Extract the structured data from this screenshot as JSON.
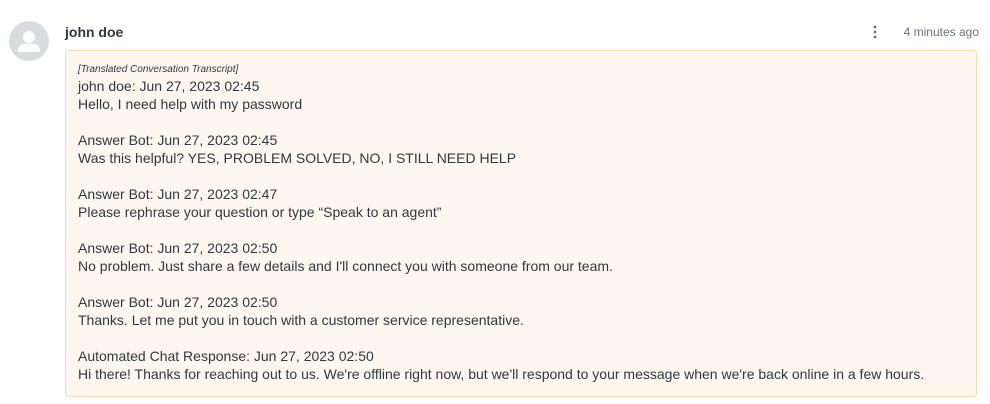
{
  "comment": {
    "author": "john doe",
    "timestamp": "4 minutes ago",
    "avatar_icon": "user-icon",
    "menu_icon": "more-vertical-icon",
    "accent_background": "#fef7ef",
    "accent_border": "#f8d9b3",
    "transcript_header": "[Translated Conversation Transcript]",
    "entries": [
      {
        "header": "john doe: Jun 27, 2023 02:45",
        "text": "Hello, I need help with my password"
      },
      {
        "header": "Answer Bot: Jun 27, 2023 02:45",
        "text": "Was this helpful? YES, PROBLEM SOLVED, NO, I STILL NEED HELP"
      },
      {
        "header": "Answer Bot: Jun 27, 2023 02:47",
        "text": "Please rephrase your question or type “Speak to an agent”"
      },
      {
        "header": "Answer Bot: Jun 27, 2023 02:50",
        "text": "No problem. Just share a few details and I'll connect you with someone from our team."
      },
      {
        "header": "Answer Bot: Jun 27, 2023 02:50",
        "text": "Thanks. Let me put you in touch with a customer service representative."
      },
      {
        "header": "Automated Chat Response: Jun 27, 2023 02:50",
        "text": "Hi there! Thanks for reaching out to us. We're offline right now, but we'll respond to your message when we're back online in a few hours."
      }
    ]
  }
}
